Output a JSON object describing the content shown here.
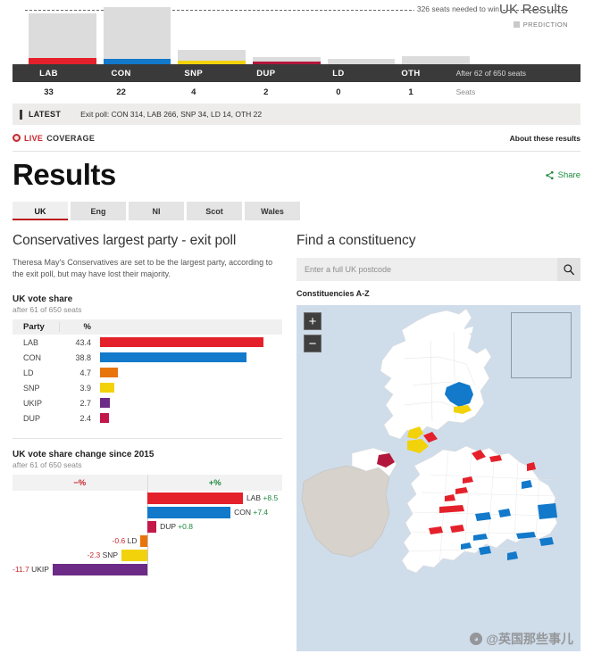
{
  "scoreboard": {
    "title": "UK Results",
    "prediction_key": "PREDICTION",
    "majority_note": "326 seats needed to win",
    "seats_note": "After 62 of 650 seats",
    "seats_row_label": "Seats",
    "parties": [
      {
        "code": "LAB",
        "seats": "33",
        "color": "#e4212a",
        "grey_h": 50,
        "actual_h": 7
      },
      {
        "code": "CON",
        "seats": "22",
        "color": "#1279cb",
        "grey_h": 58,
        "actual_h": 6
      },
      {
        "code": "SNP",
        "seats": "4",
        "color": "#f2d20a",
        "grey_h": 12,
        "actual_h": 4
      },
      {
        "code": "DUP",
        "seats": "2",
        "color": "#b2183c",
        "grey_h": 5,
        "actual_h": 3
      },
      {
        "code": "LD",
        "seats": "0",
        "color": "#dcdcdc",
        "grey_h": 6,
        "actual_h": 0
      },
      {
        "code": "OTH",
        "seats": "1",
        "color": "#cccccc",
        "grey_h": 9,
        "actual_h": 0
      }
    ]
  },
  "latest": {
    "label": "LATEST",
    "text": "Exit poll: CON 314, LAB 266, SNP 34, LD 14, OTH 22"
  },
  "live": {
    "live_word": "LIVE",
    "coverage_word": "COVERAGE",
    "about_link": "About these results"
  },
  "header": {
    "page_title": "Results",
    "share_label": "Share"
  },
  "tabs": [
    {
      "label": "UK",
      "active": true
    },
    {
      "label": "Eng",
      "active": false
    },
    {
      "label": "NI",
      "active": false
    },
    {
      "label": "Scot",
      "active": false
    },
    {
      "label": "Wales",
      "active": false
    }
  ],
  "lead": {
    "headline": "Conservatives largest party - exit poll",
    "body": "Theresa May's Conservatives are set to be the largest party, according to the exit poll, but may have lost their majority."
  },
  "search": {
    "title": "Find a constituency",
    "placeholder": "Enter a full UK postcode",
    "value": "",
    "az_label": "Constituencies A-Z",
    "search_icon": "search-icon"
  },
  "map": {
    "zoom_in": "+",
    "zoom_out": "−",
    "watermark": "@英国那些事儿"
  },
  "chart_data": [
    {
      "type": "bar",
      "title": "UK vote share",
      "subtitle": "after 61 of 650 seats",
      "columns": [
        "Party",
        "%"
      ],
      "xlabel": "",
      "ylabel": "",
      "xlim": [
        0,
        45
      ],
      "categories": [
        "LAB",
        "CON",
        "LD",
        "SNP",
        "UKIP",
        "DUP"
      ],
      "values": [
        43.4,
        38.8,
        4.7,
        3.9,
        2.7,
        2.4
      ],
      "value_labels": [
        "43.4",
        "38.8",
        "4.7",
        "3.9",
        "2.7",
        "2.4"
      ],
      "colors": [
        "#e4212a",
        "#1279cb",
        "#e8740c",
        "#f2d20a",
        "#6c2b86",
        "#c2184a"
      ]
    },
    {
      "type": "bar",
      "title": "UK vote share change since 2015",
      "subtitle": "after 61 of 650 seats",
      "neg_header": "−%",
      "pos_header": "+%",
      "xlabel": "",
      "ylabel": "",
      "xlim": [
        -12,
        12
      ],
      "categories": [
        "LAB",
        "CON",
        "DUP",
        "LD",
        "SNP",
        "UKIP"
      ],
      "values": [
        8.5,
        7.4,
        0.8,
        -0.6,
        -2.3,
        -11.7
      ],
      "labels": [
        "LAB +8.5",
        "CON +7.4",
        "DUP +0.8",
        "-0.6 LD",
        "-2.3 SNP",
        "-11.7 UKIP"
      ],
      "party_names": [
        "LAB",
        "CON",
        "DUP",
        "LD",
        "SNP",
        "UKIP"
      ],
      "value_labels": [
        "+8.5",
        "+7.4",
        "+0.8",
        "-0.6",
        "-2.3",
        "-11.7"
      ],
      "colors": [
        "#e4212a",
        "#1279cb",
        "#c2184a",
        "#e8740c",
        "#f2d20a",
        "#6c2b86"
      ]
    }
  ]
}
